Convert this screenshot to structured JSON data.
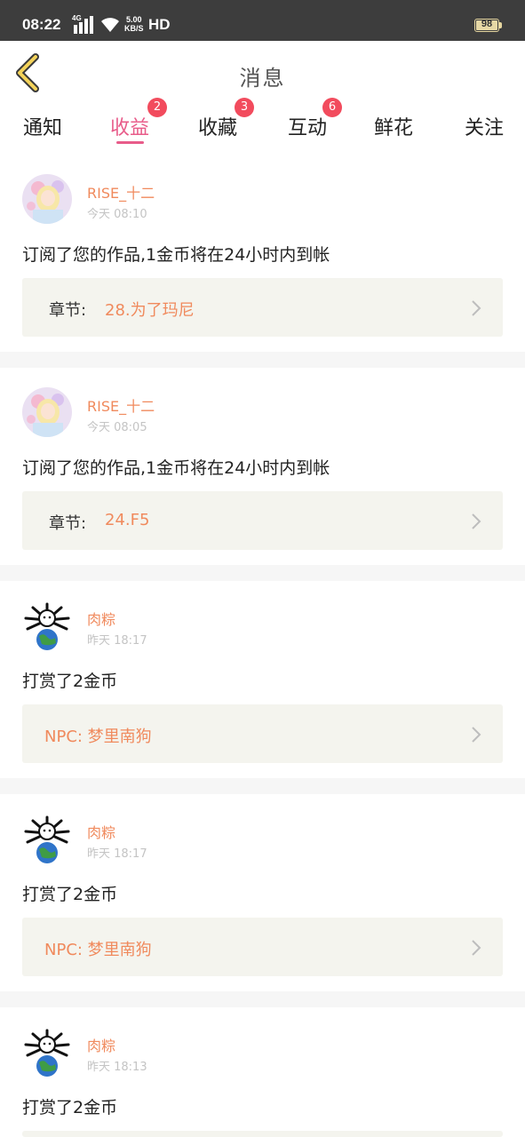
{
  "status_bar": {
    "time": "08:22",
    "network": "4G",
    "speed_value": "5.00",
    "speed_unit": "KB/S",
    "hd": "HD",
    "battery": "98"
  },
  "nav": {
    "title": "消息",
    "back_icon": "chevron-left-icon"
  },
  "tabs": [
    {
      "label": "通知",
      "badge": ""
    },
    {
      "label": "收益",
      "badge": "2",
      "active": true
    },
    {
      "label": "收藏",
      "badge": "3"
    },
    {
      "label": "互动",
      "badge": "6"
    },
    {
      "label": "鲜花",
      "badge": ""
    },
    {
      "label": "关注",
      "badge": ""
    }
  ],
  "colors": {
    "accent": "#e85c8a",
    "badge": "#f24b5d",
    "username": "#f08a5d",
    "ref_bg": "#f4f4ee"
  },
  "messages": [
    {
      "user": "RISE_十二",
      "time": "今天 08:10",
      "text": "订阅了您的作品,1金币将在24小时内到帐",
      "ref_label": "章节:",
      "ref_value": "28.为了玛尼"
    },
    {
      "user": "RISE_十二",
      "time": "今天 08:05",
      "text": "订阅了您的作品,1金币将在24小时内到帐",
      "ref_label": "章节:",
      "ref_value": "24.F5"
    },
    {
      "user": "肉粽",
      "time": "昨天 18:17",
      "text": "打赏了2金币",
      "ref_label": "",
      "ref_value": "NPC: 梦里南狗"
    },
    {
      "user": "肉粽",
      "time": "昨天 18:17",
      "text": "打赏了2金币",
      "ref_label": "",
      "ref_value": "NPC: 梦里南狗"
    },
    {
      "user": "肉粽",
      "time": "昨天 18:13",
      "text": "打赏了2金币",
      "ref_label": "",
      "ref_value": ""
    }
  ]
}
